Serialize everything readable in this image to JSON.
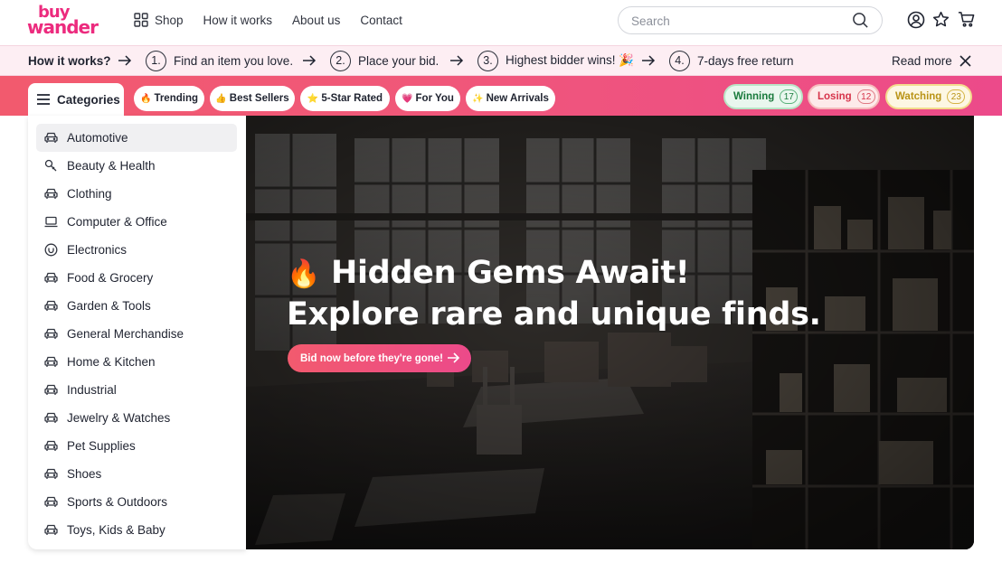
{
  "brand": {
    "line1": "buy",
    "line2": "wander",
    "color": "#ec2b7e"
  },
  "nav": {
    "shop": "Shop",
    "how_it_works": "How it works",
    "about": "About us",
    "contact": "Contact"
  },
  "search": {
    "placeholder": "Search",
    "icon": "search-icon"
  },
  "header_icons": [
    "user-icon",
    "star-icon",
    "cart-icon"
  ],
  "how_bar": {
    "title": "How it works?",
    "steps": [
      {
        "num": "1.",
        "text": "Find an item you love."
      },
      {
        "num": "2.",
        "text": "Place your bid."
      },
      {
        "num": "3.",
        "text": "Highest bidder wins! 🎉"
      },
      {
        "num": "4.",
        "text": "7-days free return"
      }
    ],
    "read_more": "Read more"
  },
  "category_bar": {
    "categories_label": "Categories",
    "chips": [
      {
        "emoji": "🔥",
        "label": "Trending"
      },
      {
        "emoji": "👍",
        "label": "Best Sellers"
      },
      {
        "emoji": "⭐",
        "label": "5-Star Rated"
      },
      {
        "emoji": "💗",
        "label": "For You"
      },
      {
        "emoji": "✨",
        "label": "New Arrivals"
      }
    ],
    "status": [
      {
        "label": "Winning",
        "count": "17",
        "color": "#197a3c"
      },
      {
        "label": "Losing",
        "count": "12",
        "color": "#d6334a"
      },
      {
        "label": "Watching",
        "count": "23",
        "color": "#b99316"
      }
    ],
    "gradient": [
      "#f25a6e",
      "#ec4a8a"
    ]
  },
  "sidebar": {
    "items": [
      {
        "label": "Automotive",
        "icon": "car-icon",
        "active": true
      },
      {
        "label": "Beauty & Health",
        "icon": "beauty-icon"
      },
      {
        "label": "Clothing",
        "icon": "car-icon"
      },
      {
        "label": "Computer & Office",
        "icon": "laptop-icon"
      },
      {
        "label": "Electronics",
        "icon": "electronics-icon"
      },
      {
        "label": "Food & Grocery",
        "icon": "car-icon"
      },
      {
        "label": "Garden & Tools",
        "icon": "car-icon"
      },
      {
        "label": "General Merchandise",
        "icon": "car-icon"
      },
      {
        "label": "Home & Kitchen",
        "icon": "car-icon"
      },
      {
        "label": "Industrial",
        "icon": "car-icon"
      },
      {
        "label": "Jewelry & Watches",
        "icon": "car-icon"
      },
      {
        "label": "Pet Supplies",
        "icon": "car-icon"
      },
      {
        "label": "Shoes",
        "icon": "car-icon"
      },
      {
        "label": "Sports & Outdoors",
        "icon": "car-icon"
      },
      {
        "label": "Toys, Kids & Baby",
        "icon": "car-icon"
      }
    ]
  },
  "hero": {
    "emoji": "🔥",
    "line1": "Hidden Gems Await!",
    "line2": "Explore rare and unique finds.",
    "cta": "Bid now before they're gone!"
  }
}
